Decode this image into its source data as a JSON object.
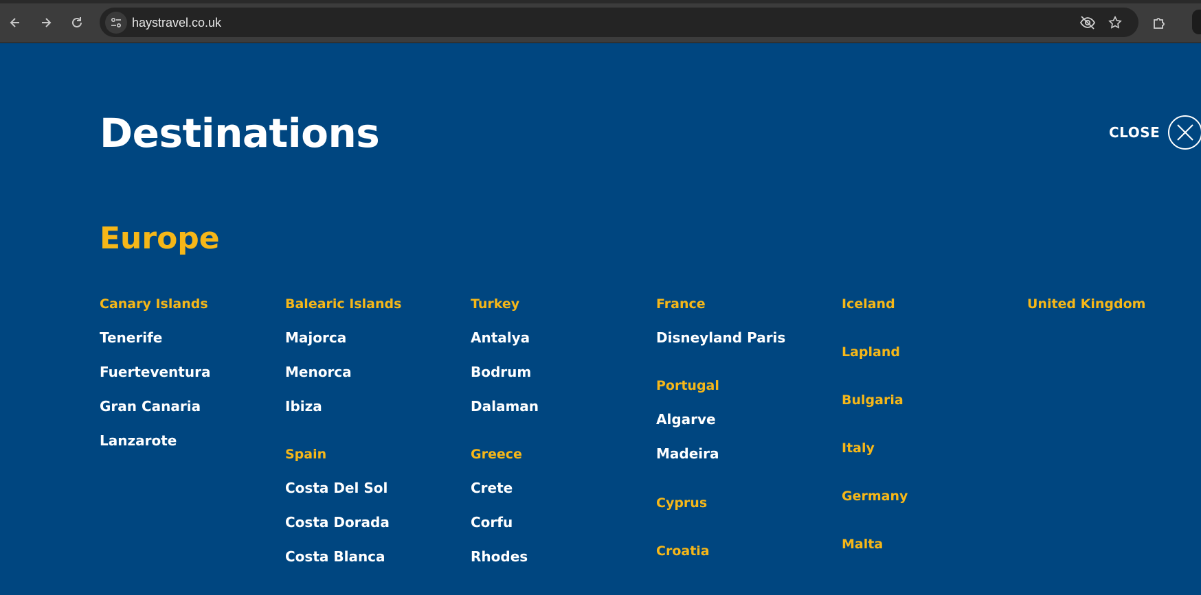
{
  "browser": {
    "url": "haystravel.co.uk",
    "icons": [
      "back-icon",
      "forward-icon",
      "reload-icon",
      "site-info-icon",
      "eye-off-icon",
      "star-icon",
      "extensions-icon"
    ]
  },
  "page": {
    "title": "Destinations",
    "close_label": "CLOSE",
    "region": "Europe"
  },
  "colors": {
    "background": "#004680",
    "accent": "#f6b718",
    "text": "#ffffff"
  },
  "columns": [
    {
      "groups": [
        {
          "heading": "Canary Islands",
          "items": [
            "Tenerife",
            "Fuerteventura",
            "Gran Canaria",
            "Lanzarote"
          ]
        }
      ]
    },
    {
      "groups": [
        {
          "heading": "Balearic Islands",
          "items": [
            "Majorca",
            "Menorca",
            "Ibiza"
          ]
        },
        {
          "heading": "Spain",
          "items": [
            "Costa Del Sol",
            "Costa Dorada",
            "Costa Blanca"
          ]
        }
      ]
    },
    {
      "groups": [
        {
          "heading": "Turkey",
          "items": [
            "Antalya",
            "Bodrum",
            "Dalaman"
          ]
        },
        {
          "heading": "Greece",
          "items": [
            "Crete",
            "Corfu",
            "Rhodes"
          ]
        }
      ]
    },
    {
      "groups": [
        {
          "heading": "France",
          "items": [
            "Disneyland Paris"
          ]
        },
        {
          "heading": "Portugal",
          "items": [
            "Algarve",
            "Madeira"
          ]
        },
        {
          "heading": "Cyprus",
          "items": []
        },
        {
          "heading": "Croatia",
          "items": []
        }
      ]
    },
    {
      "groups": [
        {
          "heading": "Iceland",
          "items": []
        },
        {
          "heading": "Lapland",
          "items": []
        },
        {
          "heading": "Bulgaria",
          "items": []
        },
        {
          "heading": "Italy",
          "items": []
        },
        {
          "heading": "Germany",
          "items": []
        },
        {
          "heading": "Malta",
          "items": []
        }
      ]
    },
    {
      "groups": [
        {
          "heading": "United Kingdom",
          "items": []
        }
      ]
    }
  ]
}
